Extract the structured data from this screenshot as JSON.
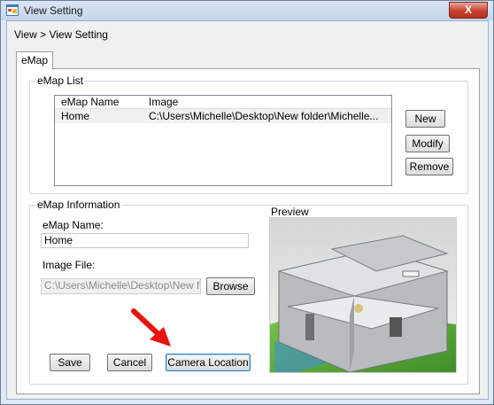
{
  "window": {
    "title": "View Setting",
    "close_label": "X"
  },
  "breadcrumb": "View > View Setting",
  "tabs": [
    {
      "label": "eMap"
    }
  ],
  "emap_list": {
    "legend": "eMap List",
    "columns": [
      "eMap Name",
      "Image"
    ],
    "rows": [
      {
        "name": "Home",
        "image": "C:\\Users\\Michelle\\Desktop\\New folder\\Michelle..."
      }
    ],
    "buttons": {
      "new": "New",
      "modify": "Modify",
      "remove": "Remove"
    }
  },
  "emap_info": {
    "legend": "eMap Information",
    "name_label": "eMap Name:",
    "name_value": "Home",
    "image_label": "Image File:",
    "image_value": "C:\\Users\\Michelle\\Desktop\\New folder",
    "browse_label": "Browse",
    "preview_label": "Preview",
    "buttons": {
      "save": "Save",
      "cancel": "Cancel",
      "camera_location": "Camera Location"
    }
  },
  "colors": {
    "arrow": "#e8140e",
    "window_frame": "#dfe9f5",
    "focus": "#3c7fb1"
  },
  "icons": {
    "app": "app-window-icon",
    "annotation": "red-arrow-icon"
  }
}
